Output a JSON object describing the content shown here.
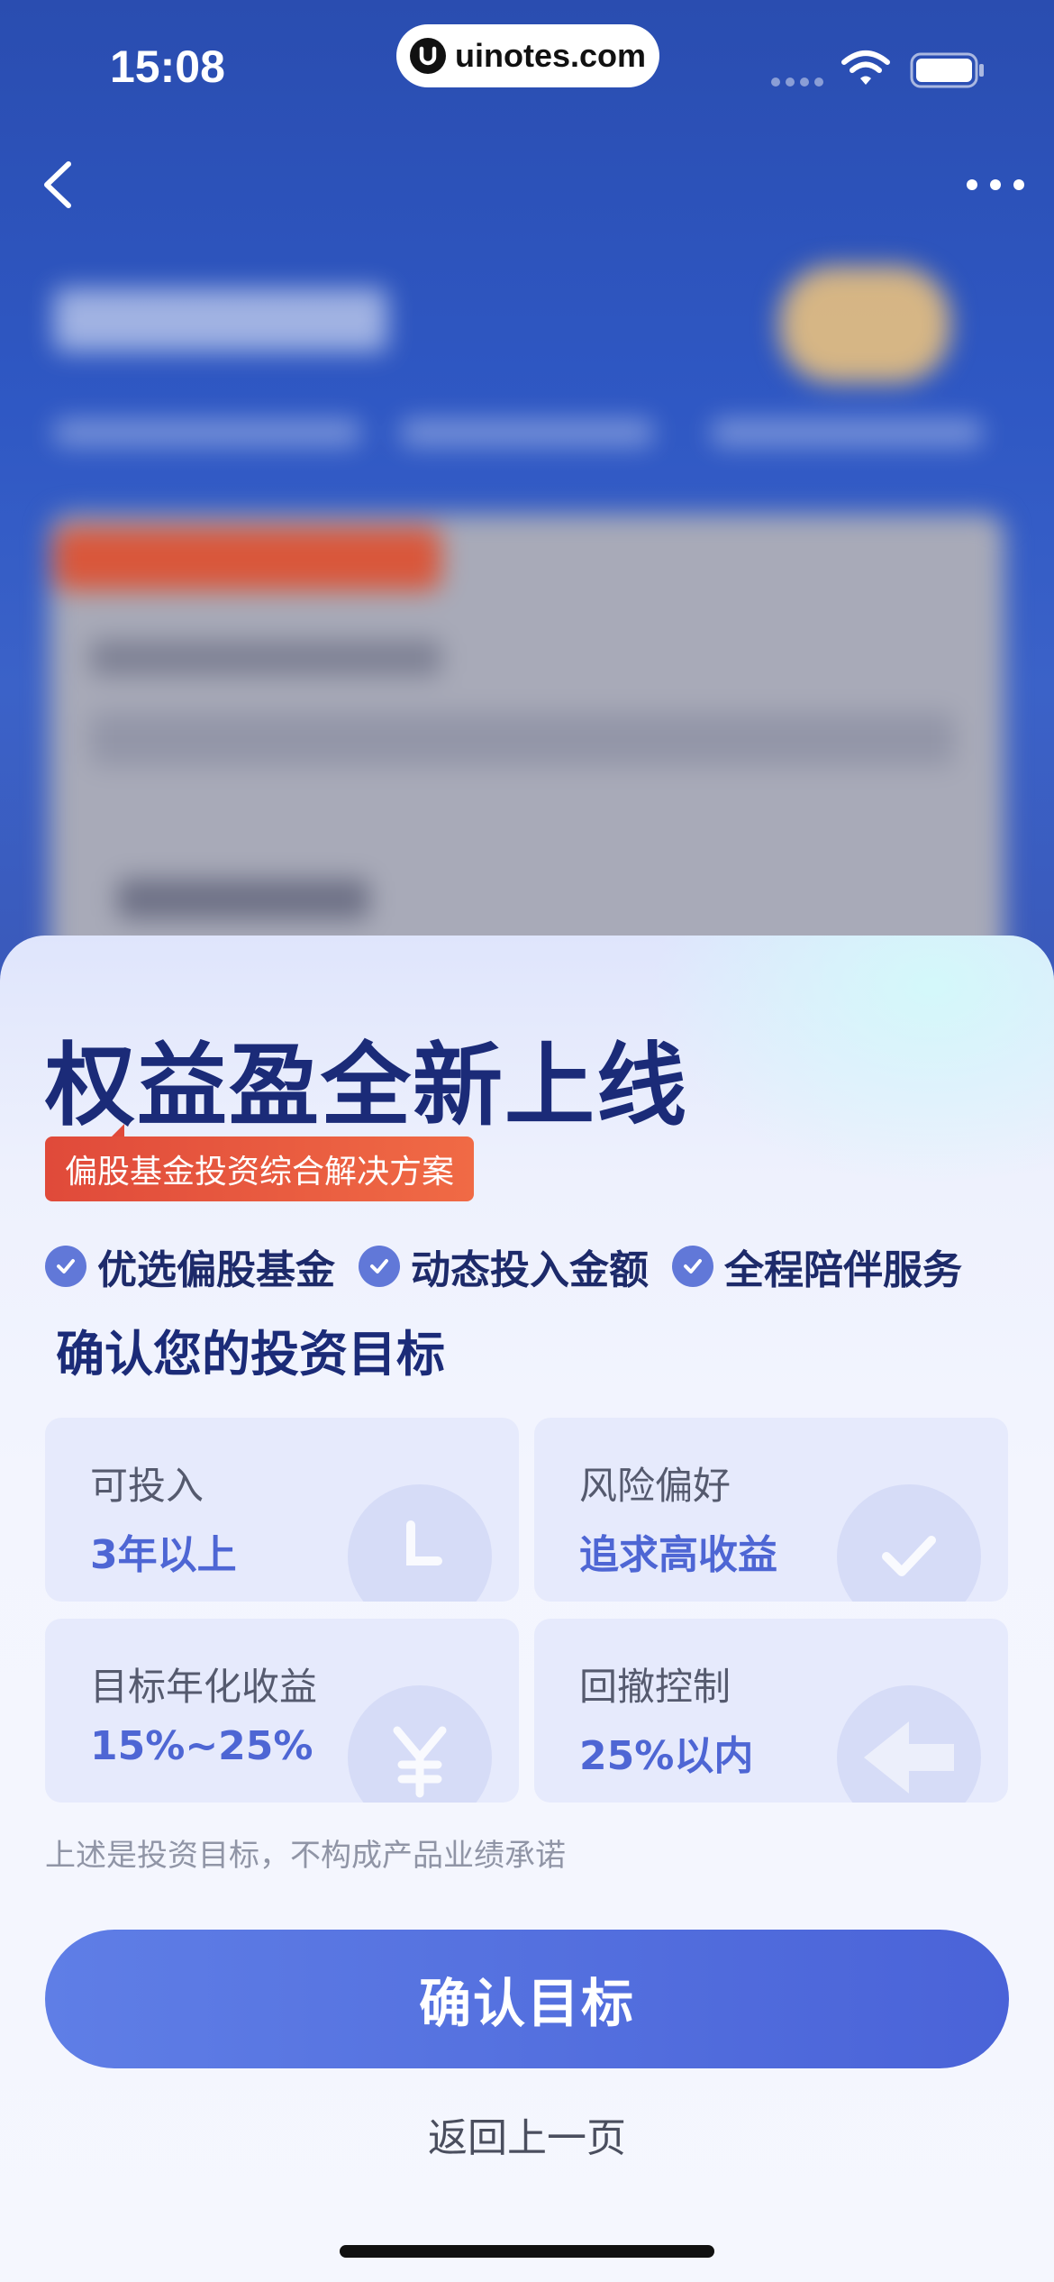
{
  "status_bar": {
    "time": "15:08",
    "url": "uinotes.com",
    "icons": [
      "signal-icon",
      "wifi-icon",
      "battery-icon"
    ]
  },
  "nav": {
    "back_icon": "chevron-left-icon",
    "more_icon": "more-dots-icon"
  },
  "sheet": {
    "title": "权益盈全新上线",
    "tag": "偏股基金投资综合解决方案",
    "features": [
      {
        "label": "优选偏股基金",
        "icon": "check-circle-icon"
      },
      {
        "label": "动态投入金额",
        "icon": "check-circle-icon"
      },
      {
        "label": "全程陪伴服务",
        "icon": "check-circle-icon"
      }
    ],
    "section_title": "确认您的投资目标",
    "goals": [
      {
        "label": "可投入",
        "value": "3年以上",
        "icon": "clock-icon"
      },
      {
        "label": "风险偏好",
        "value": "追求高收益",
        "icon": "shield-check-icon"
      },
      {
        "label": "目标年化收益",
        "value": "15%~25%",
        "icon": "yen-coin-icon"
      },
      {
        "label": "回撤控制",
        "value": "25%以内",
        "icon": "arrow-icon"
      }
    ],
    "disclaimer": "上述是投资目标，不构成产品业绩承诺",
    "confirm_button": "确认目标",
    "back_link": "返回上一页"
  },
  "colors": {
    "brand_dark": "#1b2b78",
    "accent": "#4e66d4",
    "tag_red": "#e04a3a",
    "button": "#5570e0"
  }
}
